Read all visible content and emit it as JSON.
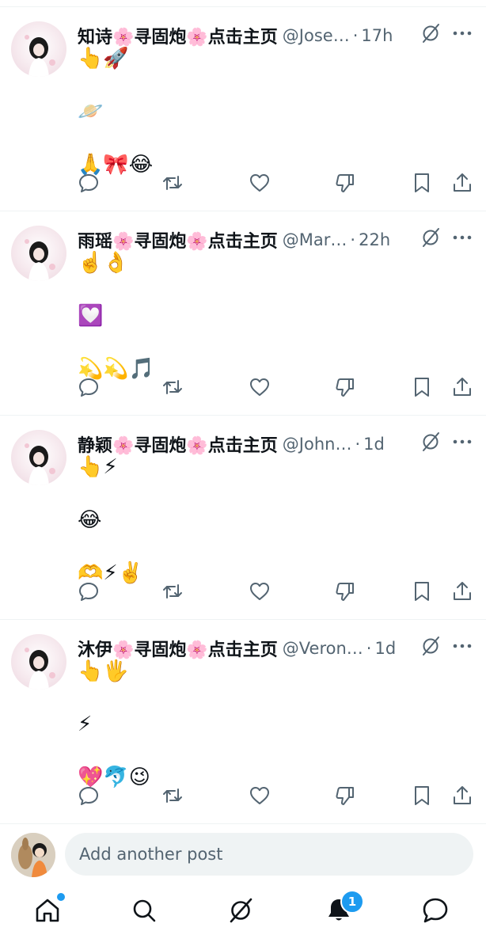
{
  "posts": [
    {
      "author": "知诗🌸寻固炮🌸点击主页",
      "handle": "@Jose…",
      "time": "17h",
      "lines": [
        "👆🚀",
        "🪐",
        "🙏🎀😂"
      ]
    },
    {
      "author": "雨瑶🌸寻固炮🌸点击主页",
      "handle": "@Mar…",
      "time": "22h",
      "lines": [
        "☝️👌",
        "💟",
        "💫💫🎵"
      ]
    },
    {
      "author": "静颖🌸寻固炮🌸点击主页",
      "handle": "@John…",
      "time": "1d",
      "lines": [
        "👆⚡",
        "😂",
        "🫶⚡✌️"
      ]
    },
    {
      "author": "沐伊🌸寻固炮🌸点击主页",
      "handle": "@Veron…",
      "time": "1d",
      "lines": [
        "👆🖐",
        "⚡",
        "💖🐬😉"
      ]
    }
  ],
  "separator": "·",
  "composer": {
    "placeholder": "Add another post"
  },
  "tabbar": {
    "notifications_badge": "1"
  },
  "icons": {
    "post_actions": [
      "reply-icon",
      "retweet-icon",
      "like-icon",
      "dislike-icon",
      "bookmark-icon",
      "share-icon"
    ],
    "tabs": [
      "home-icon",
      "search-icon",
      "grok-icon",
      "notifications-icon",
      "messages-icon"
    ]
  },
  "colors": {
    "accent": "#1d9bf0",
    "text": "#0f1419",
    "secondary": "#536471",
    "divider": "#eff3f4"
  }
}
